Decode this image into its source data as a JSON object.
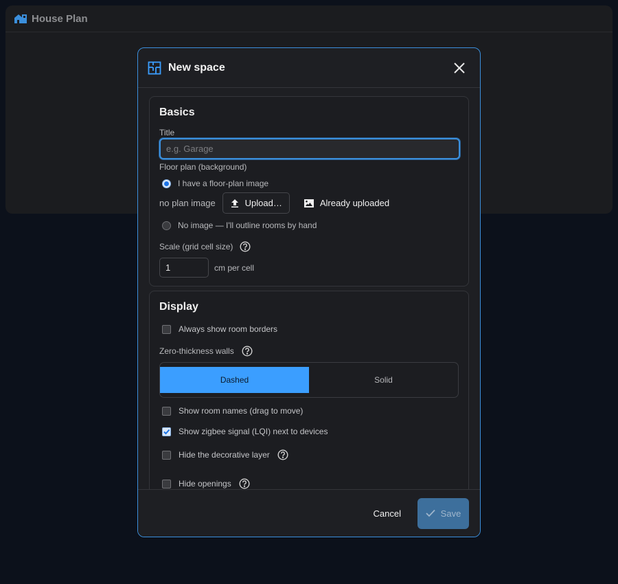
{
  "app": {
    "title": "House Plan"
  },
  "dialog": {
    "title": "New space",
    "basics": {
      "heading": "Basics",
      "title_label": "Title",
      "title_placeholder": "e.g. Garage",
      "floorplan_label": "Floor plan (background)",
      "option_image": "I have a floor-plan image",
      "no_plan_text": "no plan image",
      "upload_label": "Upload…",
      "already_uploaded_label": "Already uploaded",
      "option_no_image": "No image — I'll outline rooms by hand",
      "scale_label": "Scale (grid cell size)",
      "scale_value": "1",
      "scale_unit": "cm per cell"
    },
    "display": {
      "heading": "Display",
      "always_show_borders": "Always show room borders",
      "zero_walls_label": "Zero-thickness walls",
      "seg_dashed": "Dashed",
      "seg_solid": "Solid",
      "show_room_names": "Show room names (drag to move)",
      "show_zigbee": "Show zigbee signal (LQI) next to devices",
      "hide_decorative": "Hide the decorative layer",
      "hide_openings": "Hide openings"
    },
    "footer": {
      "cancel": "Cancel",
      "save": "Save"
    }
  },
  "colors": {
    "accent": "#3b9eff",
    "border_focus": "#3b8fdc",
    "background": "#0c111b"
  }
}
